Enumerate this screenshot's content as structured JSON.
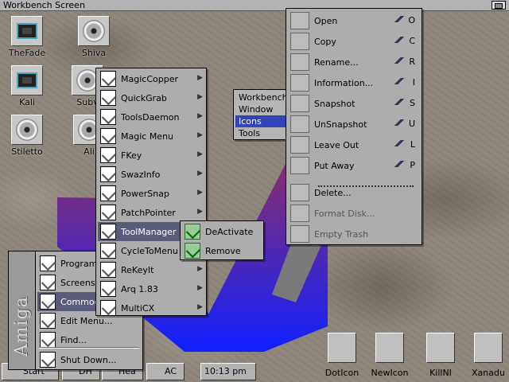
{
  "screen": {
    "title": "Workbench Screen"
  },
  "desktop_icons": [
    {
      "label": "TheFade",
      "icon": "cpu-chip-icon"
    },
    {
      "label": "Shiva",
      "icon": "harddisk-icon"
    },
    {
      "label": "Kali",
      "icon": "cpu-chip-icon"
    },
    {
      "label": "Subv",
      "icon": "harddisk-icon"
    },
    {
      "label": "Stiletto",
      "icon": "harddisk-icon"
    },
    {
      "label": "Ali",
      "icon": "harddisk-icon"
    }
  ],
  "commodities_menu": {
    "items": [
      {
        "label": "MagicCopper",
        "submenu": true
      },
      {
        "label": "QuickGrab",
        "submenu": true
      },
      {
        "label": "ToolsDaemon",
        "submenu": true
      },
      {
        "label": "Magic Menu",
        "submenu": true
      },
      {
        "label": "FKey",
        "submenu": true
      },
      {
        "label": "SwazInfo",
        "submenu": true
      },
      {
        "label": "PowerSnap",
        "submenu": true
      },
      {
        "label": "PatchPointer",
        "submenu": true
      },
      {
        "label": "ToolManager",
        "submenu": true,
        "selected": true
      },
      {
        "label": "CycleToMenu",
        "submenu": true
      },
      {
        "label": "ReKeyIt",
        "submenu": true
      },
      {
        "label": "Arq 1.83",
        "submenu": true
      },
      {
        "label": "MultiCX",
        "submenu": true
      }
    ]
  },
  "toolmanager_menu": {
    "items": [
      {
        "label": "DeActivate"
      },
      {
        "label": "Remove"
      }
    ]
  },
  "start_menu": {
    "side_label": "Amiga",
    "items": [
      {
        "label": "Programs",
        "icon": "programs-icon"
      },
      {
        "label": "Screens",
        "icon": "screens-icon"
      },
      {
        "label": "Commodities",
        "icon": "commodities-icon",
        "selected": true
      },
      {
        "label": "Edit Menu...",
        "icon": "edit-menu-icon"
      },
      {
        "label": "Find...",
        "icon": "find-icon"
      },
      {
        "label": "Shut Down...",
        "icon": "shutdown-icon"
      }
    ]
  },
  "workbench_menu": {
    "items": [
      {
        "label": "Workbench"
      },
      {
        "label": "Window"
      },
      {
        "label": "Icons",
        "selected": true
      },
      {
        "label": "Tools"
      }
    ]
  },
  "icons_menu": {
    "items": [
      {
        "label": "Open",
        "shortcut": "O",
        "icon": "open-icon"
      },
      {
        "label": "Copy",
        "shortcut": "C",
        "icon": "copy-icon"
      },
      {
        "label": "Rename...",
        "shortcut": "R",
        "icon": "rename-icon"
      },
      {
        "label": "Information...",
        "shortcut": "I",
        "icon": "information-icon"
      },
      {
        "label": "Snapshot",
        "shortcut": "S",
        "icon": "snapshot-icon"
      },
      {
        "label": "UnSnapshot",
        "shortcut": "U",
        "icon": "unsnapshot-icon"
      },
      {
        "label": "Leave Out",
        "shortcut": "L",
        "icon": "leave-out-icon"
      },
      {
        "label": "Put Away",
        "shortcut": "P",
        "icon": "put-away-icon"
      },
      {
        "label": "Delete...",
        "icon": "delete-icon"
      },
      {
        "label": "Format Disk...",
        "icon": "format-disk-icon",
        "disabled": true
      },
      {
        "label": "Empty Trash",
        "icon": "trash-icon",
        "disabled": true
      }
    ]
  },
  "taskbar": {
    "start_label": "Start",
    "tasks": [
      "DH",
      "Hea",
      "AC"
    ],
    "clock": "10:13 pm"
  },
  "dock_icons": [
    {
      "label": "DotIcon"
    },
    {
      "label": "NewIcon"
    },
    {
      "label": "KillNI"
    },
    {
      "label": "Xanadu"
    }
  ],
  "colors": {
    "menu_bg": "#adadad",
    "selection": "#3344bb",
    "gradient_top": "#7a2b6a",
    "gradient_bottom": "#1020ff"
  }
}
